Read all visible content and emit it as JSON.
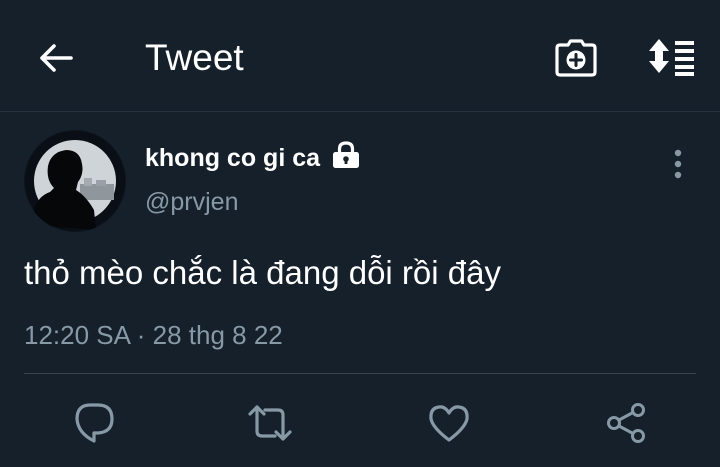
{
  "header": {
    "title": "Tweet",
    "back_icon": "arrow-left-icon",
    "camera_icon": "camera-plus-icon",
    "sort_icon": "sort-list-icon"
  },
  "tweet": {
    "display_name": "khong co gi ca",
    "username": "@prvjen",
    "protected_icon": "lock-icon",
    "text": "thỏ mèo chắc là đang dỗi rồi đây",
    "timestamp": "12:20 SA · 28 thg 8 22"
  },
  "actions": [
    {
      "icon": "reply-icon"
    },
    {
      "icon": "retweet-icon"
    },
    {
      "icon": "like-icon"
    },
    {
      "icon": "share-icon"
    }
  ],
  "colors": {
    "background": "#15202b",
    "text_primary": "#ffffff",
    "text_secondary": "#8899a6",
    "divider": "#38444d"
  }
}
